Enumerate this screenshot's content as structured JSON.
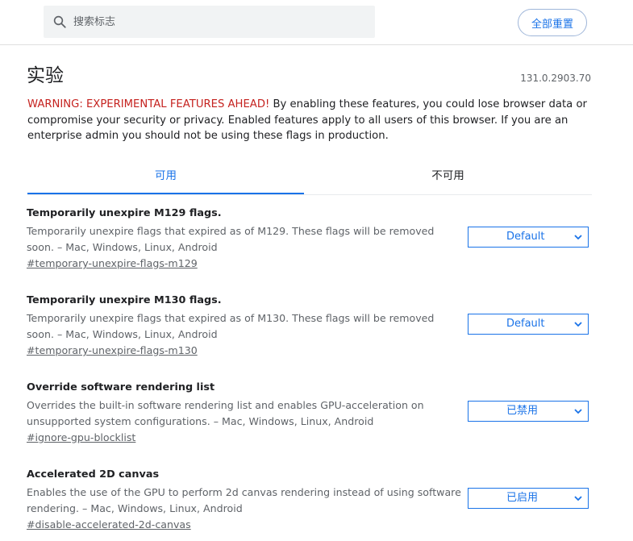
{
  "header": {
    "search_placeholder": "搜索标志",
    "reset_label": "全部重置"
  },
  "page": {
    "title": "实验",
    "version": "131.0.2903.70"
  },
  "warning": {
    "head": "WARNING: EXPERIMENTAL FEATURES AHEAD!",
    "body": " By enabling these features, you could lose browser data or compromise your security or privacy. Enabled features apply to all users of this browser. If you are an enterprise admin you should not be using these flags in production."
  },
  "tabs": [
    {
      "label": "可用"
    },
    {
      "label": "不可用"
    }
  ],
  "flags": [
    {
      "title": "Temporarily unexpire M129 flags.",
      "description": "Temporarily unexpire flags that expired as of M129. These flags will be removed soon. – Mac, Windows, Linux, Android",
      "link": "#temporary-unexpire-flags-m129",
      "value": "Default"
    },
    {
      "title": "Temporarily unexpire M130 flags.",
      "description": "Temporarily unexpire flags that expired as of M130. These flags will be removed soon. – Mac, Windows, Linux, Android",
      "link": "#temporary-unexpire-flags-m130",
      "value": "Default"
    },
    {
      "title": "Override software rendering list",
      "description": "Overrides the built-in software rendering list and enables GPU-acceleration on unsupported system configurations. – Mac, Windows, Linux, Android",
      "link": "#ignore-gpu-blocklist",
      "value": "已禁用"
    },
    {
      "title": "Accelerated 2D canvas",
      "description": "Enables the use of the GPU to perform 2d canvas rendering instead of using software rendering. – Mac, Windows, Linux, Android",
      "link": "#disable-accelerated-2d-canvas",
      "value": "已启用"
    }
  ],
  "colors": {
    "accent": "#1a73e8",
    "warning": "#c5221f"
  }
}
